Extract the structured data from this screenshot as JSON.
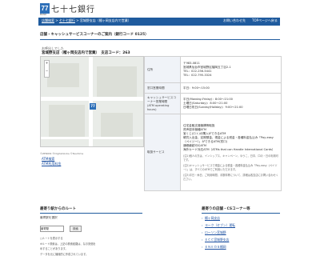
{
  "header": {
    "logo_mark": "77",
    "logo_sub": "BANK",
    "bank_name": "七十七銀行"
  },
  "navbar": {
    "crumbs": [
      "店舗検索",
      "七十七銀行",
      "宮城野支店（榴ヶ岡支店内で営業）"
    ],
    "top_links": [
      "お問い合わせ先",
      "TOPページへ戻る"
    ]
  },
  "page_title": "店舗・キャッシュサービスコーナーのご案内（銀行コード 0125）",
  "store": {
    "label": "お呼出しでした",
    "name_line": "宮城野支店（榴ヶ岡支店内で営業）　支店コード：263"
  },
  "map": {
    "pin": "77",
    "credit": "©ZENRIN ©DigitalGlobe ©Navitime"
  },
  "links": [
    "ATM検索",
    "ATM利用料金"
  ],
  "info": {
    "address_label": "住所",
    "address": "〒983-0811\n宮城県仙台市宮城野区榴岡五丁目2-1\nTEL：022-256-5441\nTEL：022-795-3324",
    "hours_label": "窓口営業時間",
    "hours": "平日：9:00～15:00",
    "atm_label": "キャッシュサービスコーナー営業時間\n(ATM operating hours)",
    "atm_lines": [
      "平日(Monday-Friday)：8:00～21:00",
      "土曜日(Saturday)：8:00～21:00",
      "日曜日祝日(Sunday/Holiday)：9:00～21:00"
    ],
    "service_label": "取扱サービス",
    "service_lines": [
      "住宅金融支援機構等取扱",
      "資声認本機種ATM",
      "宝くじ(ロト)の購入ができるATM",
      "硬貨入出金、定期預金、現金による税金・各種料金払込み「Pay-easy（ペイジー）」ができるATM(窓口)",
      "通帳繰越可のATM",
      "海外カード対応ATM（ATMs that can Handle International Cards）"
    ],
    "service_notes": [
      "(注1)個人の方は、インシップス、キャンペーン、ゆうこ、日中、口の・日の利用可です。",
      "(注2)キャッシュサービスで現金による税金・各種料金払込み「Pay-easy（ペイジー）」は、すべてのATMでご利用いただけます。",
      "(注3)平日・休日、ご利用時間、手数料等について、詳細は各支店にお問い合わせください。"
    ]
  },
  "route": {
    "title": "最寄り駅からのルート",
    "subtitle": "最寄駅を選択",
    "select_value": "最寄駅",
    "button": "検索",
    "texts": [
      "□ルートを表示する",
      "※ルート検索は、上記の検索経路は、なお安価を",
      "めすることがあります。",
      "データを元に機械的に作成されています。"
    ]
  },
  "nearby": {
    "title": "最寄りの店舗・CSコーナー等",
    "items": [
      "榴ヶ岡支店",
      "ヨーク（セブン）運転",
      "ローソン宮城野",
      "ＥＣＣ宮城野支店",
      "ＥＮＥＯＳ榴岡"
    ]
  }
}
